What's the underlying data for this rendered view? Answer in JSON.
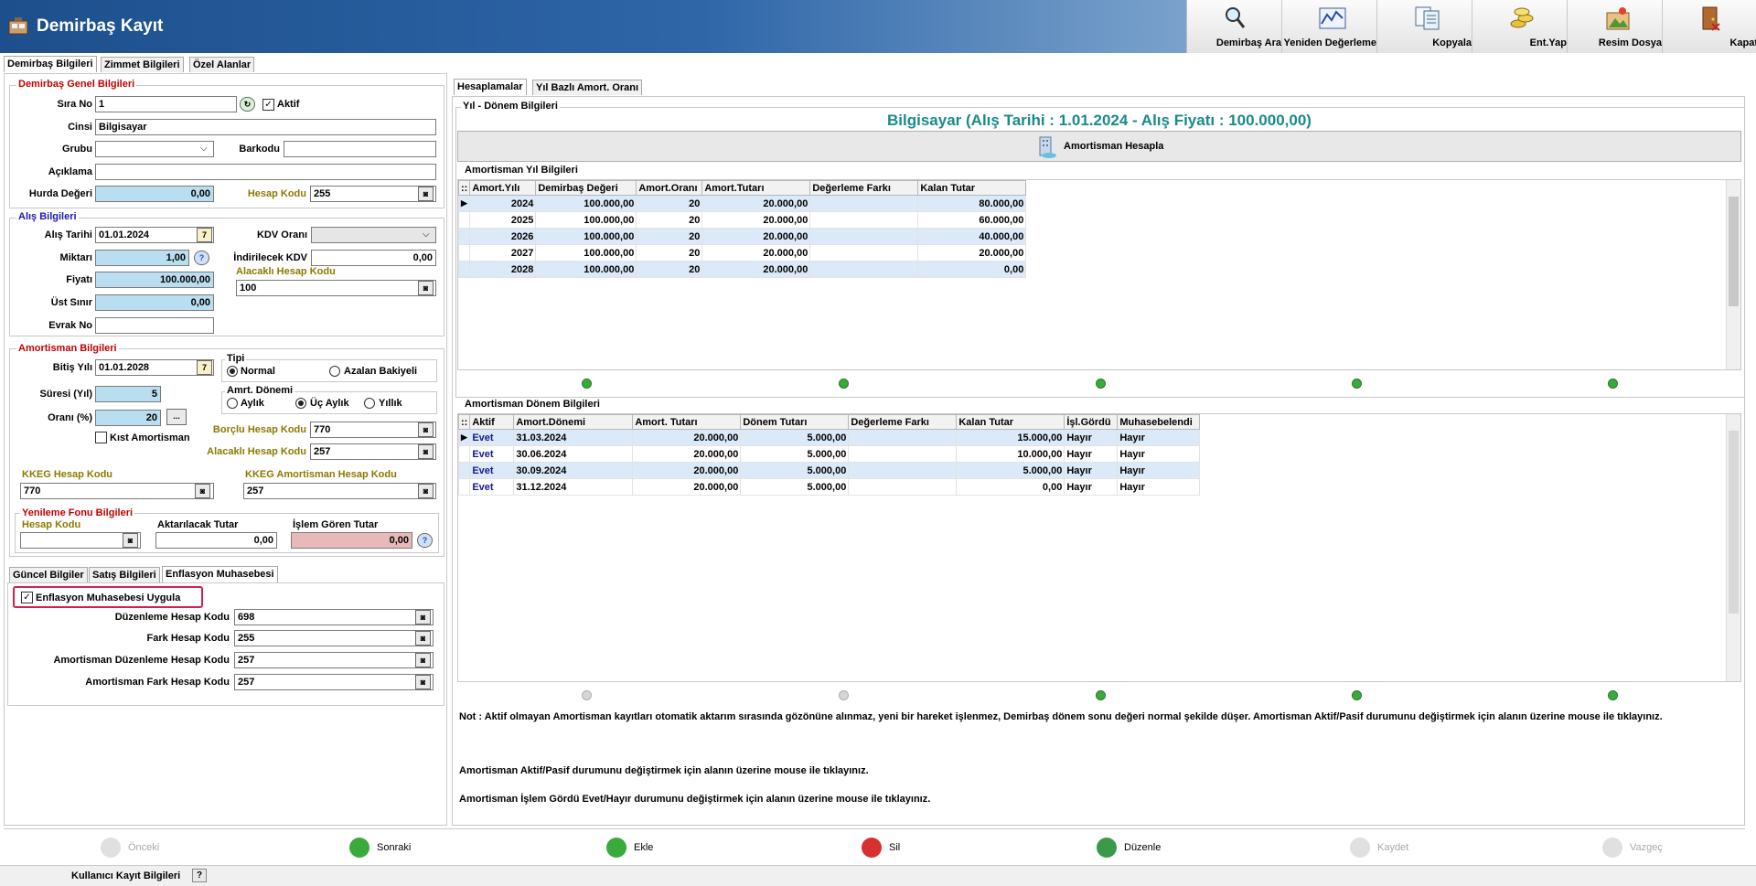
{
  "window": {
    "title": "Demirbaş Kayıt"
  },
  "toolbar": [
    {
      "label": "Demirbaş Ara",
      "icon": "magnifier-icon"
    },
    {
      "label": "Yeniden Değerleme",
      "icon": "chart-icon"
    },
    {
      "label": "Kopyala",
      "icon": "copy-icon"
    },
    {
      "label": "Ent.Yap",
      "icon": "coins-icon"
    },
    {
      "label": "Resim Dosya",
      "icon": "image-file-icon"
    },
    {
      "label": "Kapat",
      "icon": "exit-door-icon"
    }
  ],
  "left_tabs": [
    "Demirbaş Bilgileri",
    "Zimmet Bilgileri",
    "Özel Alanlar"
  ],
  "general": {
    "title": "Demirbaş Genel Bilgileri",
    "sira_no_label": "Sıra No",
    "sira_no": "1",
    "aktif_label": "Aktif",
    "cinsi_label": "Cinsi",
    "cinsi": "Bilgisayar",
    "grubu_label": "Grubu",
    "grubu": "",
    "barkodu_label": "Barkodu",
    "barkodu": "",
    "aciklama_label": "Açıklama",
    "aciklama": "",
    "hurda_label": "Hurda Değeri",
    "hurda": "0,00",
    "hesap_kodu_label": "Hesap Kodu",
    "hesap_kodu": "255"
  },
  "purchase": {
    "title": "Alış Bilgileri",
    "alis_tarihi_label": "Alış Tarihi",
    "alis_tarihi": "01.01.2024",
    "kdv_label": "KDV Oranı",
    "kdv": "",
    "miktar_label": "Miktarı",
    "miktar": "1,00",
    "ind_kdv_label": "İndirilecek KDV",
    "ind_kdv": "0,00",
    "fiyat_label": "Fiyatı",
    "fiyat": "100.000,00",
    "alacakli_label": "Alacaklı Hesap Kodu",
    "alacakli": "100",
    "ust_sinir_label": "Üst Sınır",
    "ust_sinir": "0,00",
    "evrak_label": "Evrak No",
    "evrak": ""
  },
  "depreciation": {
    "title": "Amortisman Bilgileri",
    "bitis_label": "Bitiş Yılı",
    "bitis": "01.01.2028",
    "tipi_label": "Tipi",
    "normal_label": "Normal",
    "azalan_label": "Azalan Bakiyeli",
    "suresi_label": "Süresi (Yıl)",
    "suresi": "5",
    "donem_label": "Amrt. Dönemi",
    "aylik_label": "Aylık",
    "uc_aylik_label": "Üç Aylık",
    "yillik_label": "Yıllık",
    "orani_label": "Oranı (%)",
    "orani": "20",
    "dots": "...",
    "kist_label": "Kıst Amortisman",
    "borclu_label": "Borçlu Hesap Kodu",
    "borclu": "770",
    "alacakli_label": "Alacaklı Hesap Kodu",
    "alacakli": "257",
    "kkeg_label": "KKEG Hesap Kodu",
    "kkeg": "770",
    "kkeg_am_label": "KKEG Amortisman Hesap Kodu",
    "kkeg_am": "257"
  },
  "renewal": {
    "title": "Yenileme Fonu Bilgileri",
    "hesap_label": "Hesap Kodu",
    "hesap": "",
    "aktar_label": "Aktarılacak Tutar",
    "aktar": "0,00",
    "islem_label": "İşlem Gören Tutar",
    "islem": "0,00"
  },
  "bottom_tabs": [
    "Güncel Bilgiler",
    "Satış Bilgileri",
    "Enflasyon Muhasebesi"
  ],
  "inflation": {
    "apply_label": "Enflasyon Muhasebesi Uygula",
    "duzenleme_label": "Düzenleme Hesap Kodu",
    "duzenleme": "698",
    "fark_label": "Fark Hesap Kodu",
    "fark": "255",
    "am_duz_label": "Amortisman Düzenleme Hesap Kodu",
    "am_duz": "257",
    "am_fark_label": "Amortisman Fark Hesap Kodu",
    "am_fark": "257"
  },
  "right_tabs": [
    "Hesaplamalar",
    "Yıl Bazlı Amort. Oranı"
  ],
  "period": {
    "group_title": "Yıl - Dönem Bilgileri",
    "headline": "Bilgisayar (Alış Tarihi : 1.01.2024 - Alış Fiyatı : 100.000,00)",
    "calc_button": "Amortisman Hesapla"
  },
  "year_grid": {
    "title": "Amortisman Yıl Bilgileri",
    "columns": [
      "Amort.Yılı",
      "Demirbaş Değeri",
      "Amort.Oranı",
      "Amort.Tutarı",
      "Değerleme Farkı",
      "Kalan Tutar"
    ],
    "rows": [
      [
        "2024",
        "100.000,00",
        "20",
        "20.000,00",
        "",
        "80.000,00"
      ],
      [
        "2025",
        "100.000,00",
        "20",
        "20.000,00",
        "",
        "60.000,00"
      ],
      [
        "2026",
        "100.000,00",
        "20",
        "20.000,00",
        "",
        "40.000,00"
      ],
      [
        "2027",
        "100.000,00",
        "20",
        "20.000,00",
        "",
        "20.000,00"
      ],
      [
        "2028",
        "100.000,00",
        "20",
        "20.000,00",
        "",
        "0,00"
      ]
    ]
  },
  "period_grid": {
    "title": "Amortisman Dönem Bilgileri",
    "columns": [
      "Aktif",
      "Amort.Dönemi",
      "Amort. Tutarı",
      "Dönem Tutarı",
      "Değerleme Farkı",
      "Kalan Tutar",
      "İşl.Gördü",
      "Muhasebelendi"
    ],
    "rows": [
      [
        "Evet",
        "31.03.2024",
        "20.000,00",
        "5.000,00",
        "",
        "15.000,00",
        "Hayır",
        "Hayır"
      ],
      [
        "Evet",
        "30.06.2024",
        "20.000,00",
        "5.000,00",
        "",
        "10.000,00",
        "Hayır",
        "Hayır"
      ],
      [
        "Evet",
        "30.09.2024",
        "20.000,00",
        "5.000,00",
        "",
        "5.000,00",
        "Hayır",
        "Hayır"
      ],
      [
        "Evet",
        "31.12.2024",
        "20.000,00",
        "5.000,00",
        "",
        "0,00",
        "Hayır",
        "Hayır"
      ]
    ]
  },
  "notes": {
    "n1": "Not : Aktif olmayan Amortisman kayıtları otomatik aktarım sırasında gözönüne alınmaz, yeni bir hareket işlenmez, Demirbaş dönem sonu değeri normal şekilde düşer. Amortisman Aktif/Pasif durumunu değiştirmek için alanın üzerine mouse ile tıklayınız.",
    "n2": "Amortisman Aktif/Pasif durumunu değiştirmek için alanın üzerine mouse ile tıklayınız.",
    "n3": "Amortisman İşlem Gördü Evet/Hayır durumunu değiştirmek için alanın üzerine mouse ile tıklayınız."
  },
  "bottom_bar": [
    {
      "label": "Önceki",
      "enabled": false
    },
    {
      "label": "Sonraki",
      "enabled": true
    },
    {
      "label": "Ekle",
      "enabled": true
    },
    {
      "label": "Sil",
      "enabled": true
    },
    {
      "label": "Düzenle",
      "enabled": true
    },
    {
      "label": "Kaydet",
      "enabled": false
    },
    {
      "label": "Vazgeç",
      "enabled": false
    }
  ],
  "status": {
    "label": "Kullanıcı Kayıt Bilgileri",
    "help": "?"
  },
  "colors": {
    "title_bar": "#1d4f8c",
    "highlight": "#d42050",
    "teal_headline": "#1a8a8a",
    "field_cyan": "#b9def0"
  }
}
